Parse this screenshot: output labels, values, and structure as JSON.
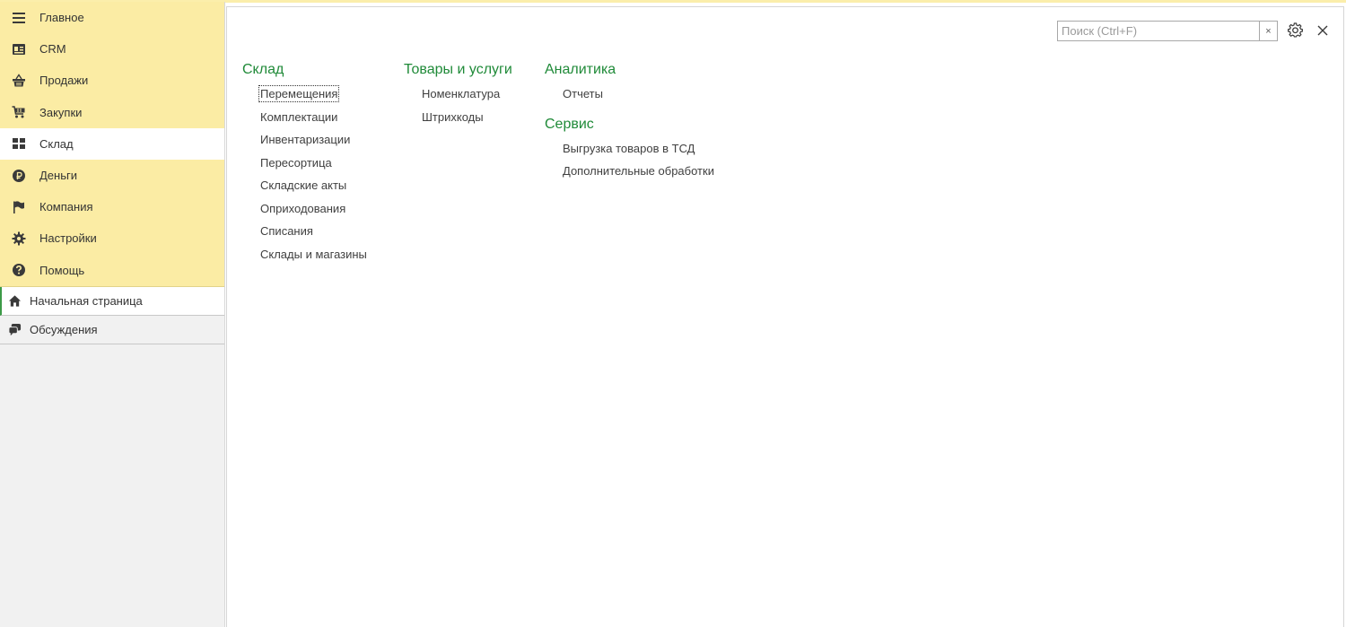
{
  "sidebar": {
    "sections": [
      {
        "label": "Главное",
        "icon": "menu-icon"
      },
      {
        "label": "CRM",
        "icon": "contact-card-icon"
      },
      {
        "label": "Продажи",
        "icon": "basket-icon"
      },
      {
        "label": "Закупки",
        "icon": "cart-icon"
      },
      {
        "label": "Склад",
        "icon": "warehouse-grid-icon",
        "active": true
      },
      {
        "label": "Деньги",
        "icon": "ruble-icon"
      },
      {
        "label": "Компания",
        "icon": "flag-icon"
      },
      {
        "label": "Настройки",
        "icon": "gear-icon"
      },
      {
        "label": "Помощь",
        "icon": "help-icon"
      }
    ],
    "links": [
      {
        "label": "Начальная страница",
        "icon": "home-icon",
        "active": true
      },
      {
        "label": "Обсуждения",
        "icon": "chat-icon"
      }
    ]
  },
  "search": {
    "placeholder": "Поиск (Ctrl+F)",
    "value": "",
    "clear_label": "×"
  },
  "columns": [
    {
      "groups": [
        {
          "title": "Склад",
          "items": [
            "Перемещения",
            "Комплектации",
            "Инвентаризации",
            "Пересортица",
            "Складские акты",
            "Оприходования",
            "Списания",
            "Склады и магазины"
          ]
        }
      ]
    },
    {
      "groups": [
        {
          "title": "Товары и услуги",
          "items": [
            "Номенклатура",
            "Штрихкоды"
          ]
        }
      ]
    },
    {
      "groups": [
        {
          "title": "Аналитика",
          "items": [
            "Отчеты"
          ]
        },
        {
          "title": "Сервис",
          "items": [
            "Выгрузка товаров в ТСД",
            "Дополнительные обработки"
          ]
        }
      ]
    }
  ],
  "colors": {
    "sidebar_bg": "#fbeca4",
    "accent_green": "#1f8a38",
    "active_marker": "#3c9a47"
  }
}
